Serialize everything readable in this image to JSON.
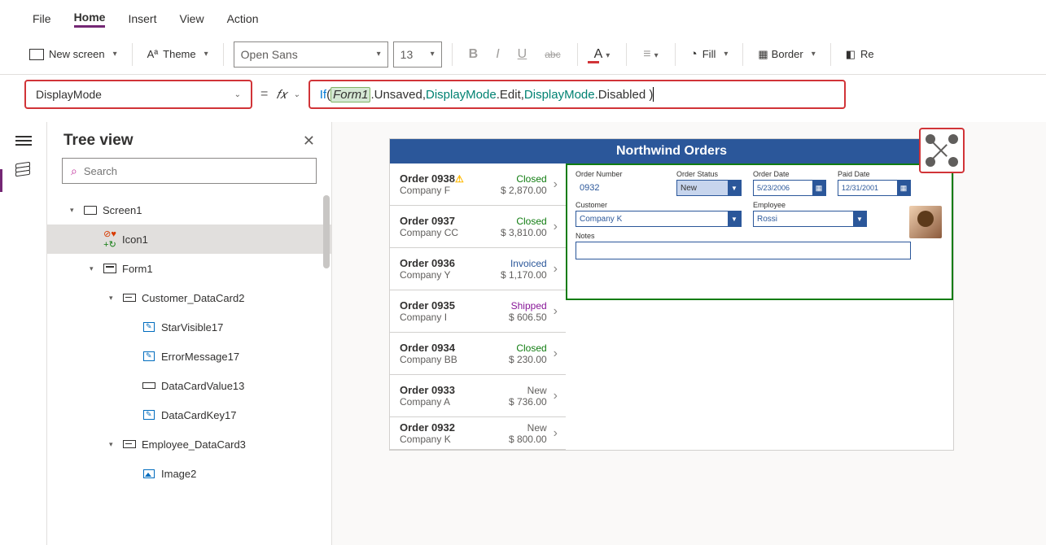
{
  "menu": {
    "items": [
      "File",
      "Home",
      "Insert",
      "View",
      "Action"
    ],
    "active": "Home"
  },
  "ribbon": {
    "new_screen": "New screen",
    "theme": "Theme",
    "font_name": "Open Sans",
    "font_size": "13",
    "fill": "Fill",
    "border": "Border",
    "re": "Re"
  },
  "property_selector": "DisplayMode",
  "formula": {
    "if": "If",
    "open": "( ",
    "ref": "Form1",
    "p1": ".Unsaved, ",
    "e1": "DisplayMode",
    "p2": ".Edit, ",
    "e2": "DisplayMode",
    "p3": ".Disabled )"
  },
  "tree": {
    "title": "Tree view",
    "search_placeholder": "Search",
    "items": [
      {
        "label": "Screen1",
        "indent": 1,
        "icon": "screen",
        "expander": "▾"
      },
      {
        "label": "Icon1",
        "indent": 2,
        "icon": "special",
        "selected": true
      },
      {
        "label": "Form1",
        "indent": 2,
        "icon": "form",
        "expander": "▾"
      },
      {
        "label": "Customer_DataCard2",
        "indent": 3,
        "icon": "card",
        "expander": "▾"
      },
      {
        "label": "StarVisible17",
        "indent": 4,
        "icon": "text"
      },
      {
        "label": "ErrorMessage17",
        "indent": 4,
        "icon": "text"
      },
      {
        "label": "DataCardValue13",
        "indent": 4,
        "icon": "input"
      },
      {
        "label": "DataCardKey17",
        "indent": 4,
        "icon": "text"
      },
      {
        "label": "Employee_DataCard3",
        "indent": 3,
        "icon": "card",
        "expander": "▾"
      },
      {
        "label": "Image2",
        "indent": 4,
        "icon": "img"
      }
    ]
  },
  "preview": {
    "title": "Northwind Orders",
    "orders": [
      {
        "num": "Order 0938",
        "warn": true,
        "company": "Company F",
        "status": "Closed",
        "amount": "$ 2,870.00"
      },
      {
        "num": "Order 0937",
        "company": "Company CC",
        "status": "Closed",
        "amount": "$ 3,810.00"
      },
      {
        "num": "Order 0936",
        "company": "Company Y",
        "status": "Invoiced",
        "amount": "$ 1,170.00"
      },
      {
        "num": "Order 0935",
        "company": "Company I",
        "status": "Shipped",
        "amount": "$ 606.50"
      },
      {
        "num": "Order 0934",
        "company": "Company BB",
        "status": "Closed",
        "amount": "$ 230.00"
      },
      {
        "num": "Order 0933",
        "company": "Company A",
        "status": "New",
        "amount": "$ 736.00"
      },
      {
        "num": "Order 0932",
        "company": "Company K",
        "status": "New",
        "amount": "$ 800.00"
      }
    ],
    "detail": {
      "labels": {
        "order_number": "Order Number",
        "order_status": "Order Status",
        "order_date": "Order Date",
        "paid_date": "Paid Date",
        "customer": "Customer",
        "employee": "Employee",
        "notes": "Notes"
      },
      "order_number": "0932",
      "order_status": "New",
      "order_date": "5/23/2006",
      "paid_date": "12/31/2001",
      "customer": "Company K",
      "employee": "Rossi"
    }
  }
}
